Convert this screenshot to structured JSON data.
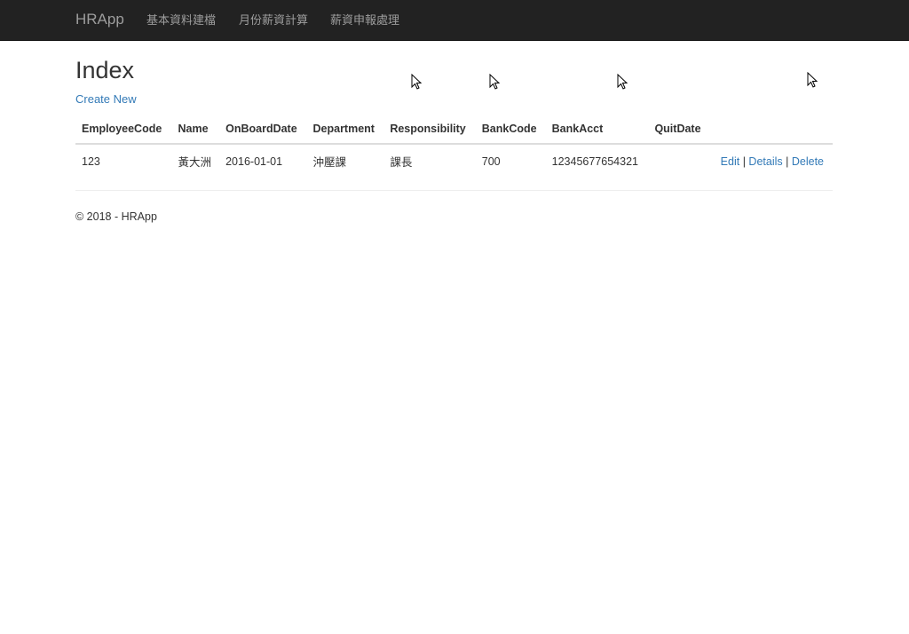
{
  "navbar": {
    "brand": "HRApp",
    "links": [
      "基本資料建檔",
      "月份薪資計算",
      "薪資申報處理"
    ]
  },
  "page": {
    "title": "Index",
    "create_new": "Create New"
  },
  "table": {
    "headers": [
      "EmployeeCode",
      "Name",
      "OnBoardDate",
      "Department",
      "Responsibility",
      "BankCode",
      "BankAcct",
      "QuitDate"
    ],
    "rows": [
      {
        "EmployeeCode": "123",
        "Name": "黃大洲",
        "OnBoardDate": "2016-01-01",
        "Department": "沖壓課",
        "Responsibility": "課長",
        "BankCode": "700",
        "BankAcct": "12345677654321",
        "QuitDate": "",
        "actions": {
          "edit": "Edit",
          "sep": "|",
          "details": "Details",
          "delete": "Delete"
        }
      }
    ]
  },
  "footer": {
    "text": "© 2018 - HRApp"
  },
  "icons": {
    "cursor": "mouse-pointer-icon"
  },
  "colors": {
    "navbar_bg": "#222222",
    "nav_text": "#9d9d9d",
    "link": "#337ab7"
  }
}
